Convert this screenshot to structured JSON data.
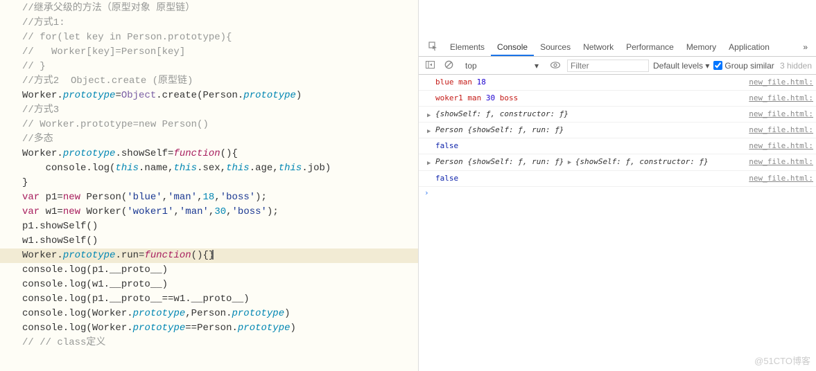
{
  "code": {
    "l1": "//继承父级的方法（原型对象 原型链）",
    "l2": "//方式1:",
    "l3": "// for(let key in Person.prototype){",
    "l4": "//   Worker[key]=Person[key]",
    "l5": "// }",
    "l6_a": "//方式2  Object.create (原型链)",
    "l7_a": "Worker.",
    "l7_b": "prototype",
    "l7_c": "=",
    "l7_d": "Object",
    "l7_e": ".create(Person.",
    "l7_f": "prototype",
    "l7_g": ")",
    "l8": "//方式3",
    "l9": "// Worker.prototype=new Person()",
    "l10": "",
    "l11": "//多态",
    "l12_a": "Worker.",
    "l12_b": "prototype",
    "l12_c": ".showSelf=",
    "l12_d": "function",
    "l12_e": "(){",
    "l13_a": "    console.log(",
    "l13_b": "this",
    "l13_c": ".name,",
    "l13_d": "this",
    "l13_e": ".sex,",
    "l13_f": "this",
    "l13_g": ".age,",
    "l13_h": "this",
    "l13_i": ".job)",
    "l14": "}",
    "l15_a": "var",
    "l15_b": " p1=",
    "l15_c": "new",
    "l15_d": " Person(",
    "l15_e": "'blue'",
    "l15_f": ",",
    "l15_g": "'man'",
    "l15_h": ",",
    "l15_i": "18",
    "l15_j": ",",
    "l15_k": "'boss'",
    "l15_l": ");",
    "l16_a": "var",
    "l16_b": " w1=",
    "l16_c": "new",
    "l16_d": " Worker(",
    "l16_e": "'woker1'",
    "l16_f": ",",
    "l16_g": "'man'",
    "l16_h": ",",
    "l16_i": "30",
    "l16_j": ",",
    "l16_k": "'boss'",
    "l16_l": ");",
    "l17": "p1.showSelf()",
    "l18": "w1.showSelf()",
    "l19_a": "Worker.",
    "l19_b": "prototype",
    "l19_c": ".run=",
    "l19_d": "function",
    "l19_e": "(){}",
    "l20": "console.log(p1.__proto__)",
    "l21": "console.log(w1.__proto__)",
    "l22": "console.log(p1.__proto__==w1.__proto__)",
    "l23_a": "console.log(Worker.",
    "l23_b": "prototype",
    "l23_c": ",Person.",
    "l23_d": "prototype",
    "l23_e": ")",
    "l24_a": "console.log(Worker.",
    "l24_b": "prototype",
    "l24_c": "==Person.",
    "l24_d": "prototype",
    "l24_e": ")",
    "l25": "",
    "l26": "// // class定义"
  },
  "devtools": {
    "tabs": {
      "elements": "Elements",
      "console": "Console",
      "sources": "Sources",
      "network": "Network",
      "performance": "Performance",
      "memory": "Memory",
      "application": "Application"
    },
    "filter": {
      "context": "top",
      "placeholder": "Filter",
      "levels": "Default levels",
      "group": "Group similar",
      "hidden": "3 hidden"
    },
    "logs": [
      {
        "type": "text",
        "parts": [
          {
            "v": "blue",
            "c": "str"
          },
          {
            "v": " ",
            "c": ""
          },
          {
            "v": "man",
            "c": "str"
          },
          {
            "v": " ",
            "c": ""
          },
          {
            "v": "18",
            "c": "num"
          }
        ],
        "src": "new_file.html:"
      },
      {
        "type": "text",
        "parts": [
          {
            "v": "woker1",
            "c": "str"
          },
          {
            "v": " ",
            "c": ""
          },
          {
            "v": "man",
            "c": "str"
          },
          {
            "v": " ",
            "c": ""
          },
          {
            "v": "30",
            "c": "num"
          },
          {
            "v": " ",
            "c": ""
          },
          {
            "v": "boss",
            "c": "str"
          }
        ],
        "src": "new_file.html:"
      },
      {
        "type": "obj",
        "expand": true,
        "label": "{showSelf: ƒ, constructor: ƒ}",
        "src": "new_file.html:"
      },
      {
        "type": "obj",
        "expand": true,
        "prefix": "Person ",
        "label": "{showSelf: ƒ, run: ƒ}",
        "src": "new_file.html:"
      },
      {
        "type": "bool",
        "v": "false",
        "src": "new_file.html:"
      },
      {
        "type": "obj2",
        "expand": true,
        "prefix1": "Person ",
        "label1": "{showSelf: ƒ, run: ƒ}",
        "label2": "{showSelf: ƒ, constructor: ƒ}",
        "src": "new_file.html:"
      },
      {
        "type": "bool",
        "v": "false",
        "src": "new_file.html:"
      }
    ],
    "prompt": "›"
  },
  "watermark": "@51CTO博客"
}
